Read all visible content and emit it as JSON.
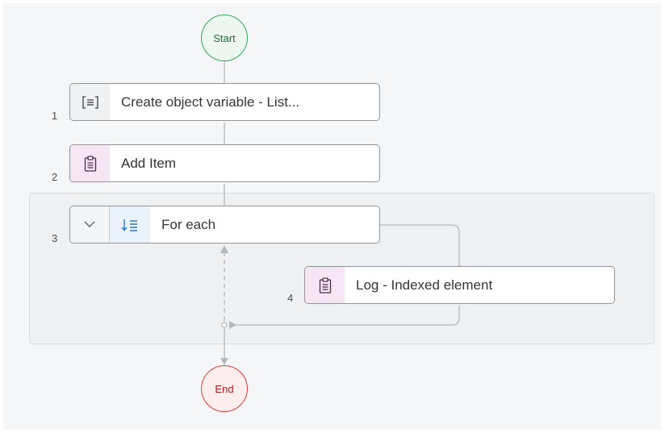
{
  "flow": {
    "start_label": "Start",
    "end_label": "End",
    "steps": [
      {
        "number": "1",
        "label": "Create object variable - List..."
      },
      {
        "number": "2",
        "label": "Add Item"
      },
      {
        "number": "3",
        "label": "For each"
      },
      {
        "number": "4",
        "label": "Log - Indexed element"
      }
    ]
  },
  "icons": {
    "step1": "variable-list-icon",
    "step2": "clipboard-icon",
    "step3_toggle": "chevron-down-icon",
    "step3": "sort-down-list-icon",
    "step4": "clipboard-icon"
  },
  "colors": {
    "start": "#3aa55b",
    "end": "#e23d3d",
    "action_icon_bg": "#f6e6f5",
    "loop_icon": "#2a7bd4"
  }
}
